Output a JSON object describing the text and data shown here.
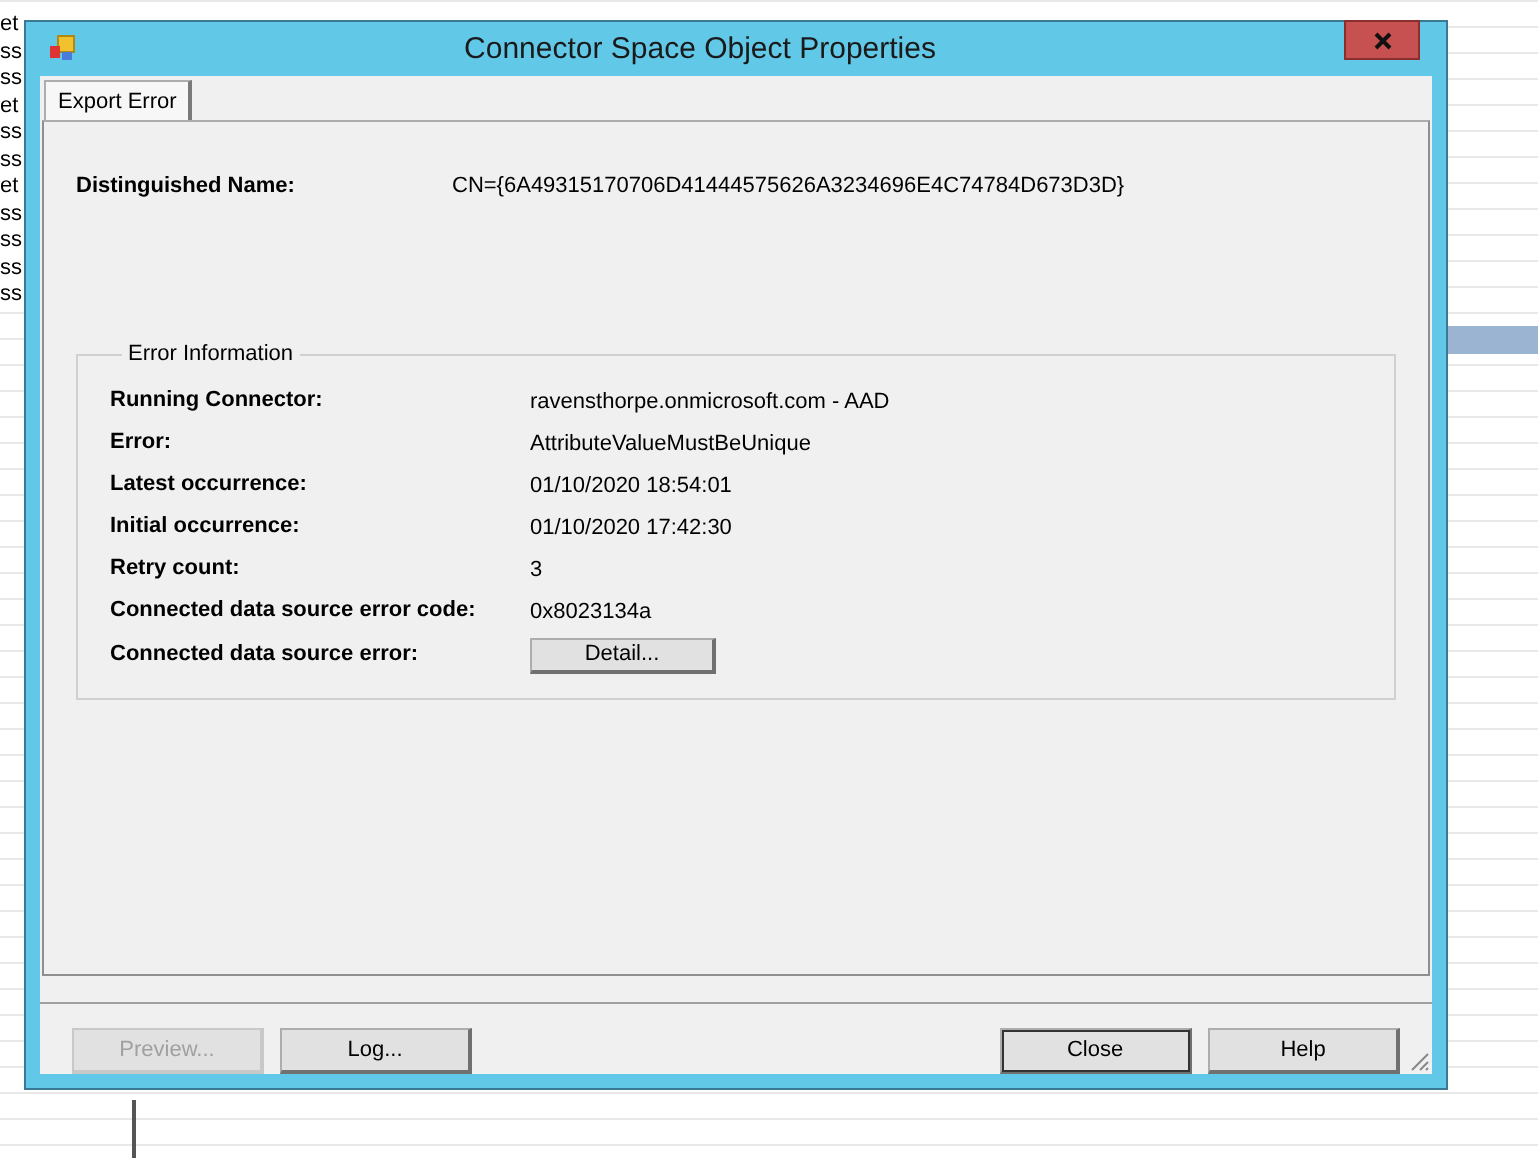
{
  "background_list": {
    "row_fragments": [
      "et",
      "ss",
      "ss",
      "et",
      "ss",
      "ss",
      "et",
      "ss",
      "ss",
      "ss",
      "ss"
    ]
  },
  "window": {
    "title": "Connector Space Object Properties"
  },
  "tabs": [
    {
      "label": "Export Error",
      "selected": true
    }
  ],
  "distinguished_name": {
    "label": "Distinguished Name:",
    "value": "CN={6A49315170706D41444575626A3234696E4C74784D673D3D}"
  },
  "error_information": {
    "title": "Error Information",
    "fields": [
      {
        "label": "Running Connector:",
        "value": "ravensthorpe.onmicrosoft.com - AAD",
        "kind": "text"
      },
      {
        "label": "Error:",
        "value": "AttributeValueMustBeUnique",
        "kind": "text"
      },
      {
        "label": "Latest occurrence:",
        "value": "01/10/2020 18:54:01",
        "kind": "text"
      },
      {
        "label": "Initial occurrence:",
        "value": "01/10/2020 17:42:30",
        "kind": "text"
      },
      {
        "label": "Retry count:",
        "value": "3",
        "kind": "text"
      },
      {
        "label": "Connected data source error code:",
        "value": "0x8023134a",
        "kind": "text"
      },
      {
        "label": "Connected data source error:",
        "value": "Detail...",
        "kind": "button"
      }
    ]
  },
  "buttons": [
    {
      "label": "Preview...",
      "disabled": true,
      "default": false
    },
    {
      "label": "Log...",
      "disabled": false,
      "default": false
    },
    {
      "label": "Close",
      "disabled": false,
      "default": true
    },
    {
      "label": "Help",
      "disabled": false,
      "default": false
    }
  ]
}
